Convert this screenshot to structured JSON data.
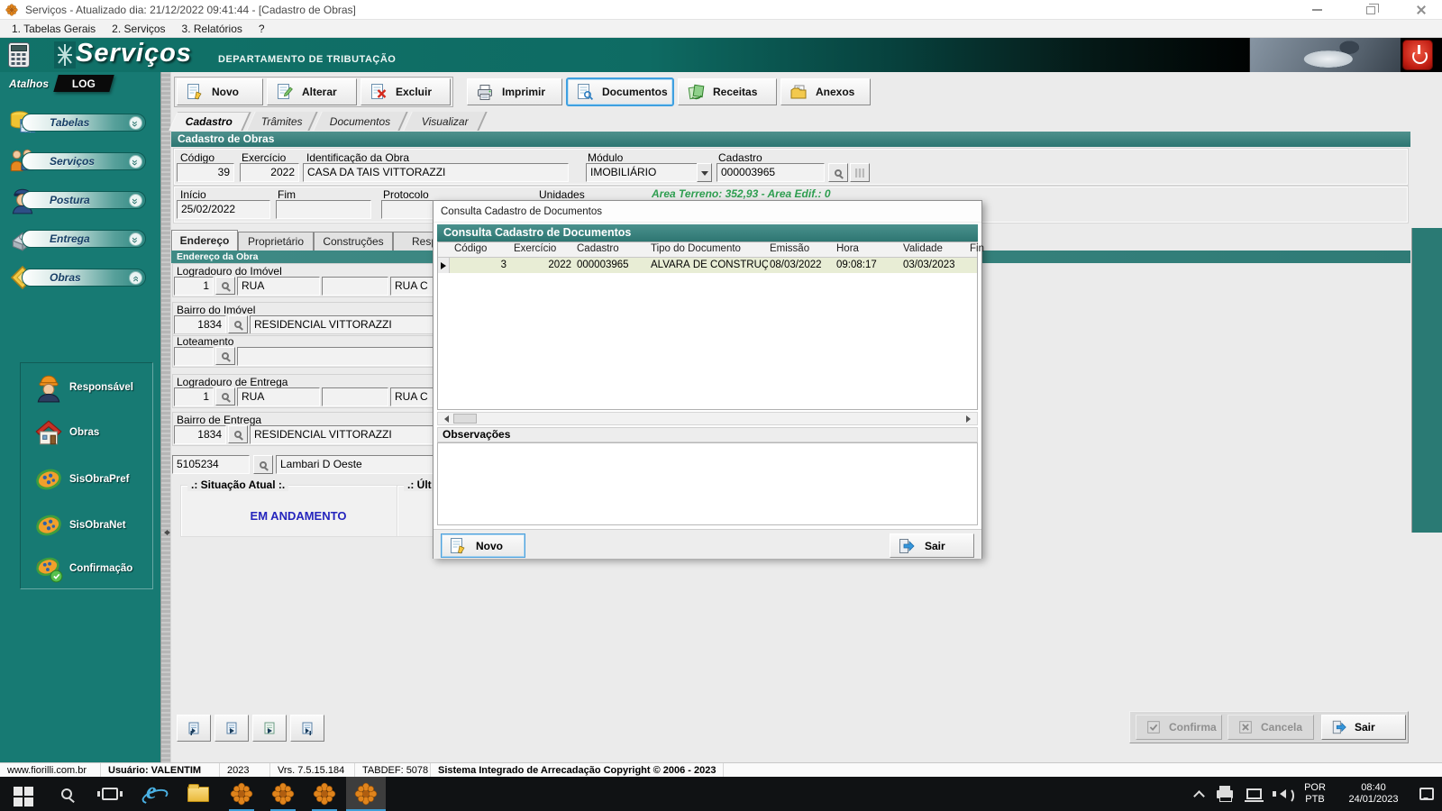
{
  "window": {
    "title": "Serviços - Atualizado dia: 21/12/2022 09:41:44 - [Cadastro de Obras]"
  },
  "menubar": {
    "items": [
      "1. Tabelas Gerais",
      "2. Serviços",
      "3. Relatórios",
      "?"
    ]
  },
  "banner": {
    "app_name": "Serviços",
    "subtitle": "DEPARTAMENTO DE TRIBUTAÇÃO"
  },
  "sidebar": {
    "tab_atalhos": "Atalhos",
    "tab_log": "LOG",
    "groups": [
      {
        "label": "Tabelas",
        "expanded": false
      },
      {
        "label": "Serviços",
        "expanded": false
      },
      {
        "label": "Postura",
        "expanded": false
      },
      {
        "label": "Entrega",
        "expanded": false
      },
      {
        "label": "Obras",
        "expanded": true
      }
    ],
    "obras_items": [
      {
        "label": "Responsável"
      },
      {
        "label": "Obras"
      },
      {
        "label": "SisObraPref"
      },
      {
        "label": "SisObraNet"
      },
      {
        "label": "Confirmação"
      }
    ]
  },
  "toolbar": {
    "buttons": [
      {
        "label": "Novo"
      },
      {
        "label": "Alterar"
      },
      {
        "label": "Excluir"
      },
      {
        "label": "Imprimir"
      },
      {
        "label": "Documentos",
        "active": true
      },
      {
        "label": "Receitas"
      },
      {
        "label": "Anexos"
      }
    ]
  },
  "page_tabs": [
    {
      "label": "Cadastro",
      "active": true
    },
    {
      "label": "Trâmites"
    },
    {
      "label": "Documentos"
    },
    {
      "label": "Visualizar"
    }
  ],
  "form": {
    "title": "Cadastro de Obras",
    "labels": {
      "codigo": "Código",
      "exercicio": "Exercício",
      "identificacao": "Identificação da Obra",
      "modulo": "Módulo",
      "cadastro": "Cadastro",
      "inicio": "Início",
      "fim": "Fim",
      "protocolo": "Protocolo",
      "unidades": "Unidades"
    },
    "values": {
      "codigo": "39",
      "exercicio": "2022",
      "identificacao": "CASA DA TAIS VITTORAZZI",
      "modulo": "IMOBILIÁRIO",
      "cadastro": "000003965",
      "inicio": "25/02/2022",
      "fim": "",
      "protocolo": ""
    },
    "area_info": "Area Terreno: 352,93 - Area Edif.: 0",
    "subtabs": [
      {
        "label": "Endereço",
        "active": true
      },
      {
        "label": "Proprietário"
      },
      {
        "label": "Construções"
      },
      {
        "label": "Resp"
      }
    ],
    "endereco": {
      "section_title": "Endereço da Obra",
      "groups": {
        "logradouro_imovel": {
          "label": "Logradouro do Imóvel",
          "codigo": "1",
          "tipo": "RUA",
          "meio": "",
          "nome": "RUA C"
        },
        "bairro_imovel": {
          "label": "Bairro do Imóvel",
          "codigo": "1834",
          "nome": "RESIDENCIAL VITTORAZZI"
        },
        "loteamento": {
          "label": "Loteamento",
          "codigo": "",
          "nome": ""
        },
        "logradouro_entrega": {
          "label": "Logradouro de Entrega",
          "codigo": "1",
          "tipo": "RUA",
          "meio": "",
          "nome": "RUA C"
        },
        "bairro_entrega": {
          "label": "Bairro de Entrega",
          "codigo": "1834",
          "nome": "RESIDENCIAL VITTORAZZI"
        },
        "municipio": {
          "codigo": "5105234",
          "nome": "Lambari D Oeste"
        }
      }
    },
    "situacao": {
      "legend": ".: Situação Atual :.",
      "value": "EM ANDAMENTO",
      "legend_right": ".: Últ"
    },
    "footer": {
      "confirma": "Confirma",
      "cancela": "Cancela",
      "sair": "Sair"
    }
  },
  "modal": {
    "window_title": "Consulta Cadastro de Documentos",
    "header": "Consulta Cadastro de Documentos",
    "columns": [
      "Código",
      "Exercício",
      "Cadastro",
      "Tipo do Documento",
      "Emissão",
      "Hora",
      "Validade",
      "Fin"
    ],
    "rows": [
      {
        "codigo": "3",
        "exercicio": "2022",
        "cadastro": "000003965",
        "tipo": "ALVARÁ DE CONSTRUÇ",
        "emissao": "08/03/2022",
        "hora": "09:08:17",
        "validade": "03/03/2023"
      }
    ],
    "observacoes_label": "Observações",
    "observacoes": "",
    "novo_label": "Novo",
    "sair_label": "Sair"
  },
  "statusbar": {
    "items": [
      "www.fiorilli.com.br",
      "Usuário: VALENTIM",
      "2023",
      "Vrs. 7.5.15.184",
      "TABDEF: 5078",
      "Sistema Integrado de Arrecadação Copyright © 2006 - 2023"
    ]
  },
  "taskbar": {
    "lang_line1": "POR",
    "lang_line2": "PTB",
    "time": "08:40",
    "date": "24/01/2023"
  },
  "icons": {
    "app": "orange-flower",
    "toolbar": [
      "document-new",
      "document-edit",
      "document-delete",
      "printer",
      "documents-search",
      "receipts-green",
      "folder-attachments"
    ],
    "lookup": "magnifier",
    "banner_right": "power-button"
  },
  "colors": {
    "banner_teal": "#0e6f68",
    "sidebar_teal": "#177a73",
    "section_teal": "#3b8683",
    "selected_row": "#e8edd5",
    "area_text_green": "#2e9e50",
    "status_value_blue": "#2525bd",
    "focus_blue": "#43a4e0"
  }
}
